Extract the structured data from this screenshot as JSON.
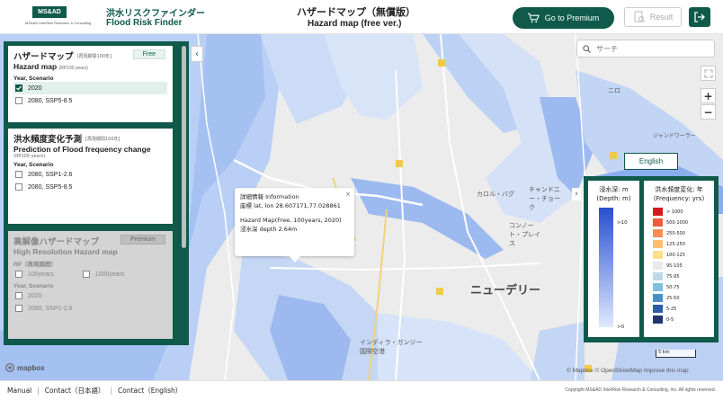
{
  "header": {
    "logo_text": "MS&AD",
    "logo_sub": "MS&AD InterRisk Research & Consulting",
    "brand_jp": "洪水リスクファインダー",
    "brand_en": "Flood Risk Finder",
    "title_jp": "ハザードマップ（無償版）",
    "title_en": "Hazard map (free ver.)",
    "premium_label": "Go to Premium",
    "result_label": "Result"
  },
  "panel": {
    "hazard": {
      "title_jp": "ハザードマップ",
      "title_note": "[再現期間100年]",
      "tag": "Free",
      "title_en": "Hazard map",
      "title_en_note": "(RP100 years)",
      "section": "Year, Scenario",
      "options": [
        "2020",
        "2080, SSP5-8.5"
      ]
    },
    "frequency": {
      "title_jp": "洪水頻度変化予測",
      "title_note": "[再現期間100年]",
      "title_en": "Prediction of Flood frequency change",
      "title_en_note": "(RP100 years)",
      "section": "Year, Scenario",
      "options": [
        "2080, SSP1-2.6",
        "2080, SSP5-8.5"
      ]
    },
    "highres": {
      "title_jp": "高解像ハザードマップ",
      "tag": "Premium",
      "title_en": "High Resolution Hazard map",
      "rp_section": "RP（再現期間）",
      "rp_options": [
        "100years",
        "1000years"
      ],
      "section": "Year, Scenario",
      "options": [
        "2020",
        "2080, SSP1-2.6"
      ]
    }
  },
  "popup": {
    "line1": "詳細情報 Information",
    "line2": "座標 lat, lon 28.607171,77.028861",
    "line3": "Hazard Map(Free, 100years, 2020)",
    "line4": "浸水深 depth 2.64m"
  },
  "map": {
    "search_placeholder": "サーチ",
    "english_label": "English",
    "city_label": "ニューデリー",
    "labels": [
      "カロル・バグ",
      "チャンドニー・チョーク",
      "コンノート・プレイス",
      "インディラ・ガンジー国際空港",
      "ニロ",
      "ジャンドワーラー"
    ],
    "scale_text": "5 km",
    "mapbox_text": "mapbox",
    "attribution": "© Mapbox © OpenStreetMap  Improve this map"
  },
  "legend": {
    "depth_title_jp": "浸水深: m",
    "depth_title_en": "(Depth: m)",
    "depth_max": ">10",
    "depth_min": ">0",
    "freq_title_jp": "洪水頻度変化: 年",
    "freq_title_en": "(Frequency: yrs)",
    "freq_items": [
      {
        "label": "> 1000",
        "color": "#d7191c"
      },
      {
        "label": "500-1000",
        "color": "#f15a3a"
      },
      {
        "label": "250-500",
        "color": "#f98e52"
      },
      {
        "label": "125-250",
        "color": "#fdbf6f"
      },
      {
        "label": "100-125",
        "color": "#ffe08a"
      },
      {
        "label": "95-105",
        "color": "#e8e8e8"
      },
      {
        "label": "75-95",
        "color": "#bcd8ea"
      },
      {
        "label": "50-75",
        "color": "#7fbfe0"
      },
      {
        "label": "25-50",
        "color": "#4a90c8"
      },
      {
        "label": "5-25",
        "color": "#2c5da8"
      },
      {
        "label": "0-5",
        "color": "#1f3570"
      }
    ]
  },
  "footer": {
    "links": [
      "Manual",
      "Contact（日本語）",
      "Contact（English）"
    ],
    "copyright": "Copyright MS&AD InterRisk Research & Consulting, Inc. All rights reserved."
  },
  "colors": {
    "brand": "#0f5a4a",
    "flood_light": "#cfe0f7",
    "flood_mid": "#8fb1ee",
    "flood_dark": "#4d79d8"
  }
}
